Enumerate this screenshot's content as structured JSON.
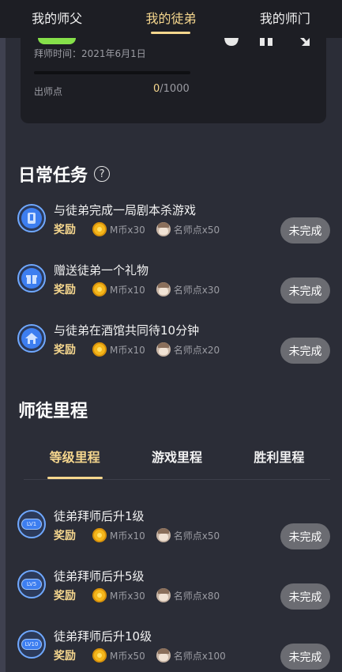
{
  "top_tabs": [
    "我的师父",
    "我的徒弟",
    "我的师门"
  ],
  "active_top_tab": 1,
  "card": {
    "since": "拜师时间：2021年6月1日",
    "points_label": "出师点",
    "points_current": "0",
    "points_total": "/1000",
    "progress_fraction": 0
  },
  "daily": {
    "title": "日常任务",
    "help_glyph": "?",
    "tasks": [
      {
        "title": "与徒弟完成一局剧本杀游戏",
        "reward_label": "奖励",
        "coin_text": "M币x30",
        "point_text": "名师点x50",
        "status": "未完成",
        "icon": "script-icon"
      },
      {
        "title": "赠送徒弟一个礼物",
        "reward_label": "奖励",
        "coin_text": "M币x10",
        "point_text": "名师点x30",
        "status": "未完成",
        "icon": "gift-icon"
      },
      {
        "title": "与徒弟在酒馆共同待10分钟",
        "reward_label": "奖励",
        "coin_text": "M币x10",
        "point_text": "名师点x20",
        "status": "未完成",
        "icon": "tavern-icon"
      }
    ]
  },
  "milestones": {
    "title": "师徒里程",
    "tabs": [
      "等级里程",
      "游戏里程",
      "胜利里程"
    ],
    "active_tab": 0,
    "items": [
      {
        "title": "徒弟拜师后升1级",
        "lv": "LV1",
        "reward_label": "奖励",
        "coin_text": "M币x10",
        "point_text": "名师点x50",
        "status": "未完成"
      },
      {
        "title": "徒弟拜师后升5级",
        "lv": "LV5",
        "reward_label": "奖励",
        "coin_text": "M币x30",
        "point_text": "名师点x80",
        "status": "未完成"
      },
      {
        "title": "徒弟拜师后升10级",
        "lv": "LV10",
        "reward_label": "奖励",
        "coin_text": "M币x50",
        "point_text": "名师点x100",
        "status": "未完成"
      }
    ]
  }
}
